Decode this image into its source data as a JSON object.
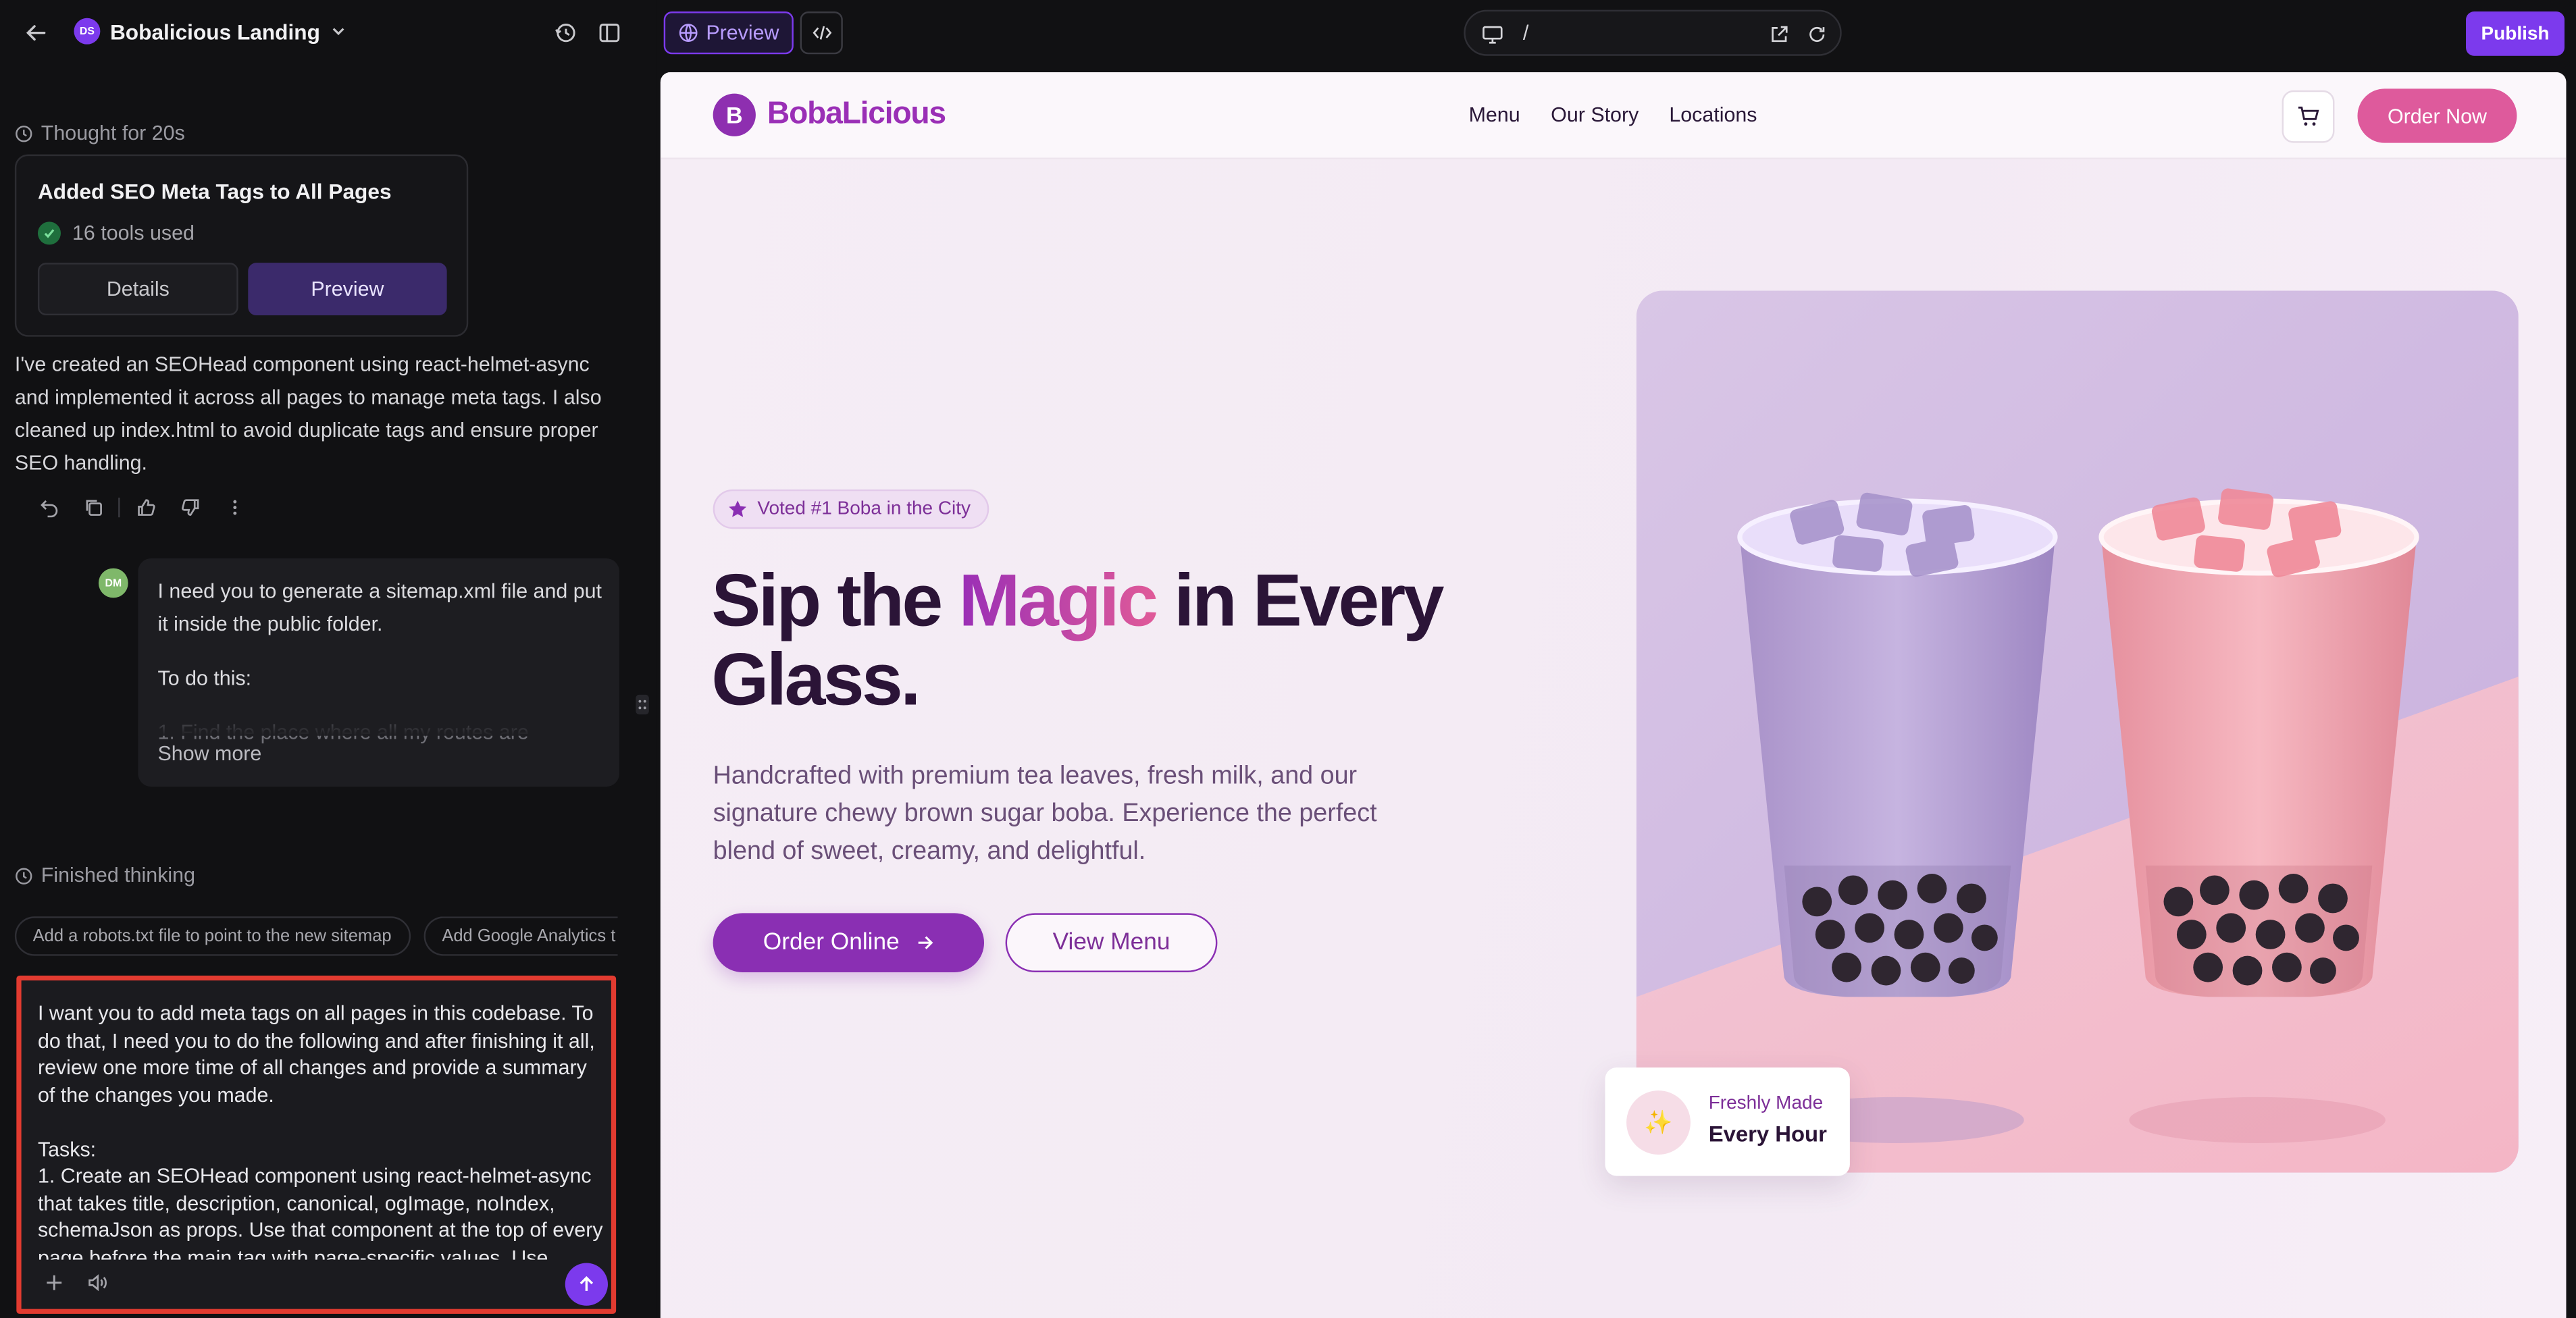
{
  "project": {
    "badge": "DS",
    "name": "Bobalicious Landing"
  },
  "chat": {
    "thought_label": "Thought for 20s",
    "card": {
      "title": "Added SEO Meta Tags to All Pages",
      "tools": "16 tools used",
      "details_label": "Details",
      "preview_label": "Preview"
    },
    "assistant_message": "I've created an SEOHead component using react-helmet-async and implemented it across all pages to manage meta tags. I also cleaned up index.html to avoid duplicate tags and ensure proper SEO handling.",
    "user_avatar": "DM",
    "user_message_p1": "I need you to generate a sitemap.xml file and put it inside the public folder.",
    "user_message_p2": "To do this:",
    "user_message_p3": "1. Find the place where all my routes are",
    "show_more": "Show more",
    "finished_label": "Finished thinking",
    "suggestions": [
      "Add a robots.txt file to point to the new sitemap",
      "Add Google Analytics t"
    ],
    "composer_text": "I want you to add meta tags on all pages in this codebase. To do that, I need you to do the following and after finishing it all, review one more time of all changes and provide a summary of the changes you made.\n\nTasks:\n1. Create an SEOHead component using react-helmet-async that takes title, description, canonical, ogImage, noIndex, schemaJson as props. Use that component at the top of every page before the main tag with page-specific values. Use"
  },
  "toolbar": {
    "preview_label": "Preview",
    "url_path": "/",
    "publish_label": "Publish"
  },
  "site": {
    "logo_letter": "B",
    "logo_text": "BobaLicious",
    "nav": [
      "Menu",
      "Our Story",
      "Locations"
    ],
    "order_now": "Order Now",
    "badge": "Voted #1 Boba in the City",
    "headline_a": "Sip the ",
    "headline_magic": "Magic",
    "headline_b": " in Every Glass.",
    "subtitle": "Handcrafted with premium tea leaves, fresh milk, and our signature chewy brown sugar boba. Experience the perfect blend of sweet, creamy, and delightful.",
    "btn_order_online": "Order Online",
    "btn_view_menu": "View Menu",
    "fresh_l1": "Freshly Made",
    "fresh_l2": "Every Hour"
  },
  "colors": {
    "accent": "#7c3aed",
    "brand_purple": "#8a2fb3",
    "brand_pink": "#de5a9c",
    "highlight_border": "#e23b30"
  }
}
